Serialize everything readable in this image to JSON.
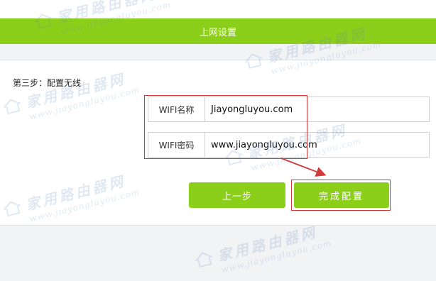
{
  "header": {
    "title": "上网设置"
  },
  "step": {
    "label": "第三步：配置无线"
  },
  "wifi_name": {
    "label": "WIFI名称",
    "value": "Jiayongluyou.com"
  },
  "wifi_password": {
    "label": "WIFI密码",
    "value": "www.jiayongluyou.com"
  },
  "buttons": {
    "prev_label": "上一步",
    "finish_label": "完成配置"
  },
  "watermark": {
    "cn": "家用路由器网",
    "en": "www.jiayongluyou.com"
  },
  "colors": {
    "accent": "#8ccf1a",
    "annotation": "#d23a3a"
  }
}
